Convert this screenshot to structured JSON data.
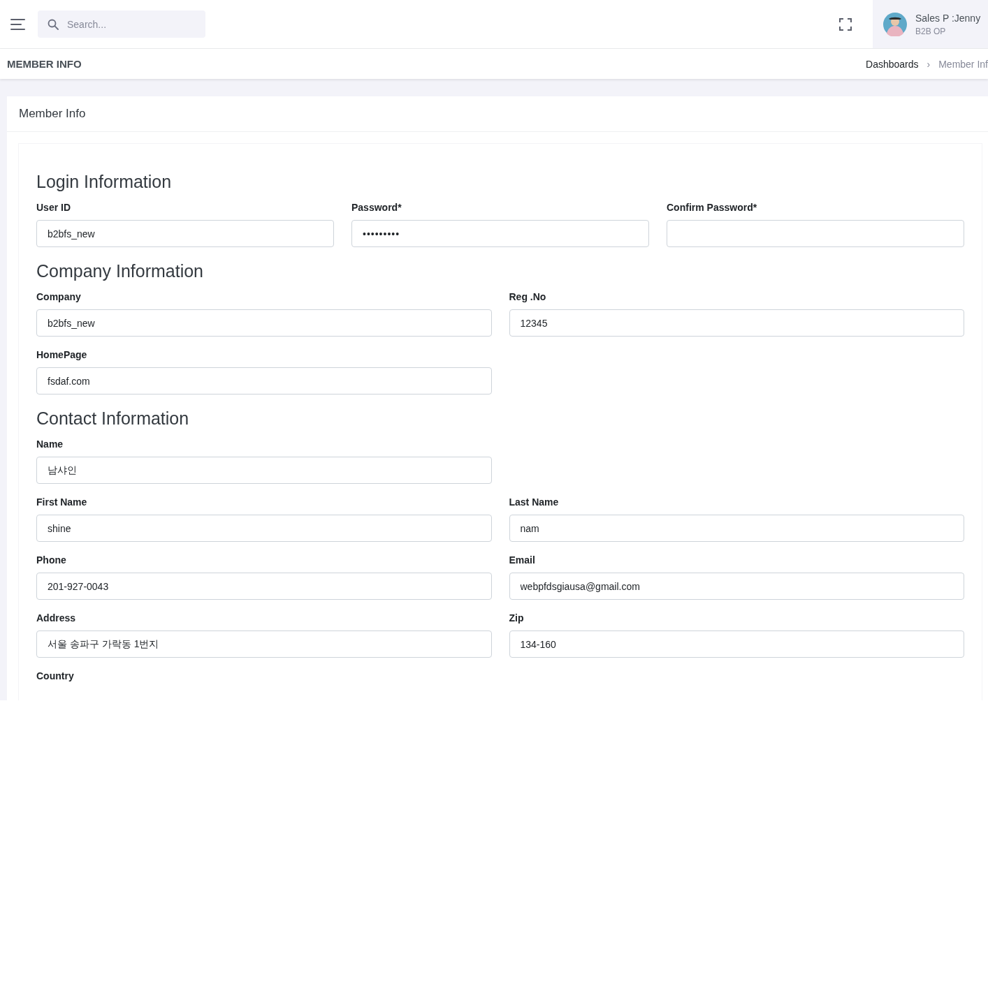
{
  "header": {
    "search": {
      "placeholder": "Search..."
    },
    "user": {
      "name": "Sales P :Jenny",
      "role": "B2B OP"
    }
  },
  "page_title": "MEMBER INFO",
  "breadcrumb": [
    {
      "label": "Dashboards",
      "separator": "›"
    },
    {
      "label": "Member Inf"
    }
  ],
  "card": {
    "title": "Member Info",
    "sections": [
      {
        "title": "Login Information",
        "rows": [
          [
            {
              "label": "User ID",
              "kind": "text",
              "value": "b2bfs_new"
            },
            {
              "label": "Password*",
              "kind": "password",
              "value": "•••••••••"
            },
            {
              "label": "Confirm Password*",
              "kind": "password"
            }
          ]
        ]
      },
      {
        "title": "Company Information",
        "rows": [
          [
            {
              "label": "Company",
              "kind": "text",
              "value": "b2bfs_new"
            },
            {
              "label": "Reg .No",
              "kind": "text",
              "value": "12345"
            }
          ],
          [
            {
              "label": "HomePage",
              "kind": "text",
              "value": "fsdaf.com"
            }
          ]
        ]
      },
      {
        "title": "Contact Information",
        "rows": [
          [
            {
              "label": "Name",
              "kind": "text",
              "value": "남샤인"
            }
          ],
          [
            {
              "label": "First Name",
              "kind": "text",
              "value": "shine"
            },
            {
              "label": "Last Name",
              "kind": "text",
              "value": "nam"
            }
          ],
          [
            {
              "label": "Phone",
              "kind": "text",
              "value": "201-927-0043"
            },
            {
              "label": "Email",
              "kind": "text",
              "value": "webpfdsgiausa@gmail.com"
            }
          ],
          [
            {
              "label": "Address",
              "kind": "text",
              "value": "서울 송파구 가락동 1번지"
            },
            {
              "label": "Zip",
              "kind": "text",
              "value": "134-160"
            }
          ],
          [
            {
              "label": "Country",
              "kind": "label"
            }
          ]
        ]
      }
    ]
  }
}
